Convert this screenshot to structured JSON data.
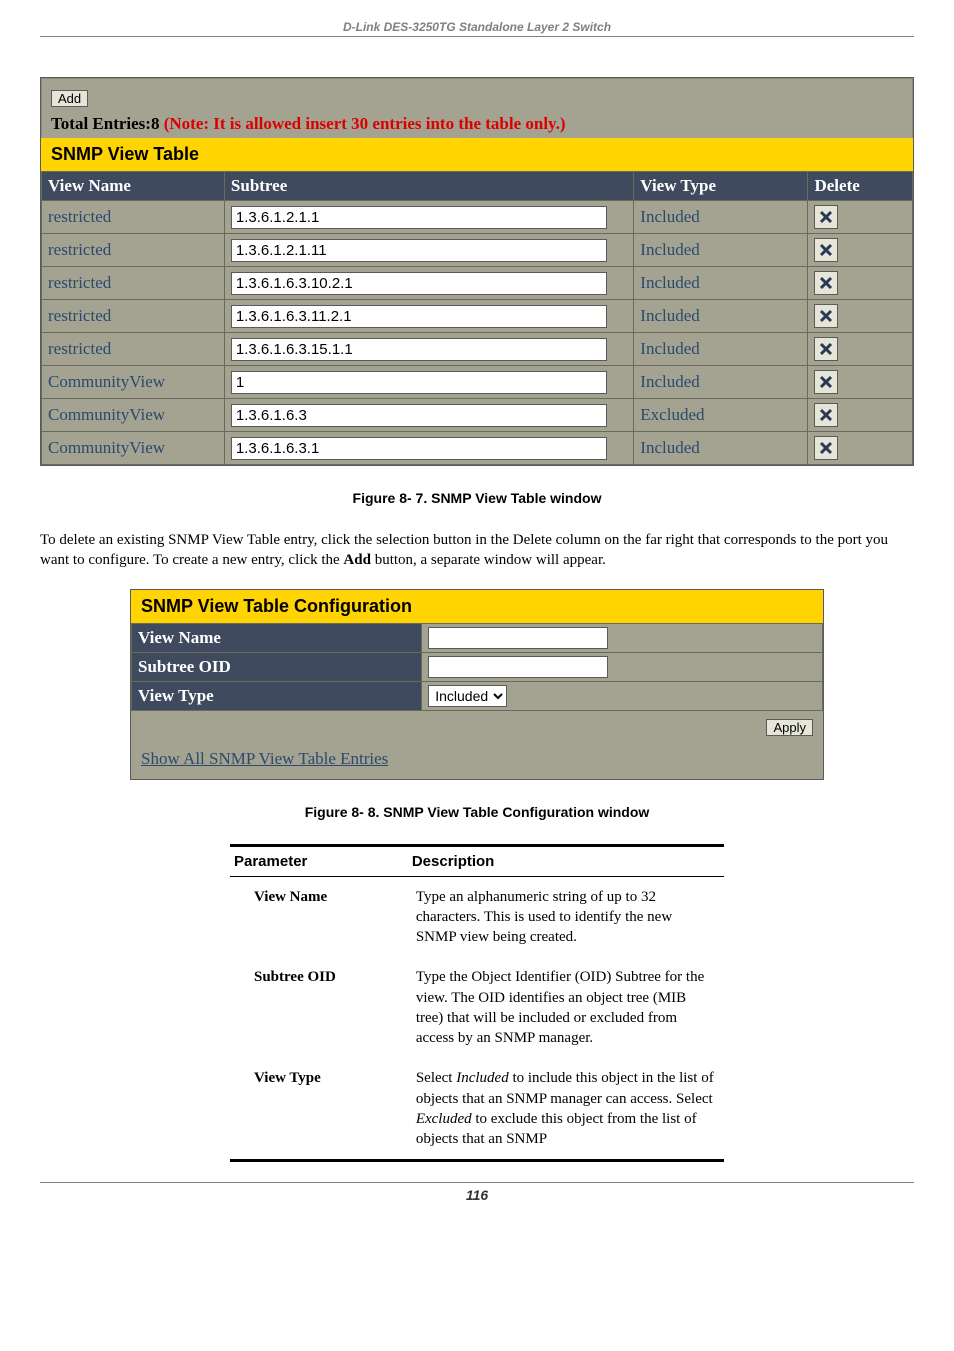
{
  "doc_header": "D-Link DES-3250TG Standalone Layer 2 Switch",
  "panel1": {
    "add_label": "Add",
    "total_entries_prefix": "Total Entries:8",
    "total_entries_note": " (Note: It is allowed insert 30 entries into the table only.)",
    "title": "SNMP View Table",
    "headers": {
      "view_name": "View Name",
      "subtree": "Subtree",
      "view_type": "View Type",
      "delete": "Delete"
    },
    "rows": [
      {
        "view_name": "restricted",
        "subtree": "1.3.6.1.2.1.1",
        "view_type": "Included"
      },
      {
        "view_name": "restricted",
        "subtree": "1.3.6.1.2.1.11",
        "view_type": "Included"
      },
      {
        "view_name": "restricted",
        "subtree": "1.3.6.1.6.3.10.2.1",
        "view_type": "Included"
      },
      {
        "view_name": "restricted",
        "subtree": "1.3.6.1.6.3.11.2.1",
        "view_type": "Included"
      },
      {
        "view_name": "restricted",
        "subtree": "1.3.6.1.6.3.15.1.1",
        "view_type": "Included"
      },
      {
        "view_name": "CommunityView",
        "subtree": "1",
        "view_type": "Included"
      },
      {
        "view_name": "CommunityView",
        "subtree": "1.3.6.1.6.3",
        "view_type": "Excluded"
      },
      {
        "view_name": "CommunityView",
        "subtree": "1.3.6.1.6.3.1",
        "view_type": "Included"
      }
    ]
  },
  "fig1_caption": "Figure 8- 7.  SNMP View Table window",
  "body_para_1a": "To delete an existing SNMP View Table entry, click the selection button in the Delete column on the far right that corresponds to the port you want to configure. To create a new entry, click the ",
  "body_para_1b": "Add",
  "body_para_1c": " button, a separate window will appear.",
  "panel2": {
    "title": "SNMP View Table Configuration",
    "labels": {
      "view_name": "View Name",
      "subtree_oid": "Subtree OID",
      "view_type": "View Type"
    },
    "view_type_value": "Included",
    "apply_label": "Apply",
    "footer_link": "Show All SNMP View Table Entries"
  },
  "fig2_caption": "Figure 8- 8.  SNMP View Table Configuration window",
  "param_table": {
    "headers": {
      "param": "Parameter",
      "desc": "Description"
    },
    "rows": [
      {
        "name": "View Name",
        "desc": "Type an alphanumeric string of up to 32 characters. This is used to identify the new SNMP view being created."
      },
      {
        "name": "Subtree OID",
        "desc": "Type the Object Identifier (OID) Subtree for the view. The OID identifies an object tree (MIB tree) that will be included or excluded from access by an SNMP manager."
      },
      {
        "name": "View Type",
        "desc_pre": "Select ",
        "desc_i1": "Included",
        "desc_mid1": " to include this object in the list of objects that an SNMP manager can access. Select ",
        "desc_i2": "Excluded",
        "desc_mid2": " to exclude this object from the list of objects that an SNMP"
      }
    ]
  },
  "page_number": "116"
}
